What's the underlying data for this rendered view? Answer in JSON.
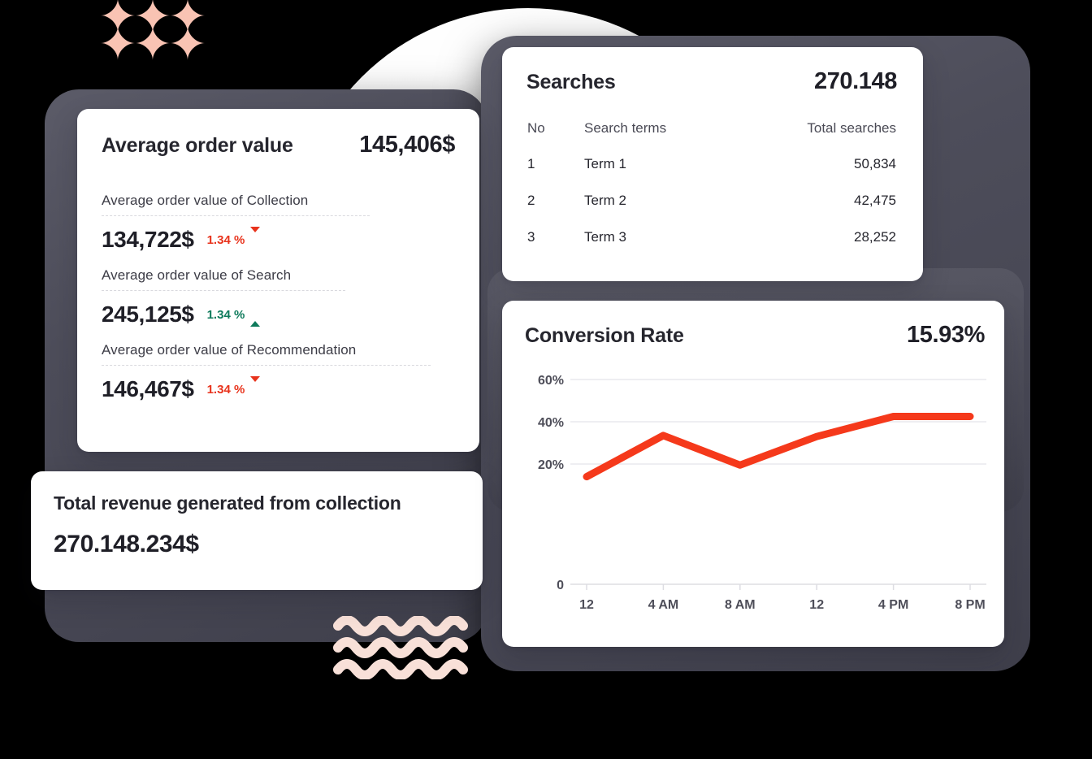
{
  "theme": {
    "background": "#000000",
    "device_frame": "#4a4a56",
    "card_background": "#ffffff",
    "text_primary": "#26262e",
    "text_secondary": "#4a4a55",
    "accent_negative": "#e8331c",
    "accent_positive": "#0e7a5b",
    "chart_line": "#f5391b",
    "decor_star": "#f9c3b3",
    "decor_wave": "#f8e0d8"
  },
  "average_order_value": {
    "title": "Average order value",
    "total": "145,406$",
    "metrics": [
      {
        "label": "Average order value of Collection",
        "value": "134,722$",
        "delta": "1.34 %",
        "direction": "down"
      },
      {
        "label": "Average order value of Search",
        "value": "245,125$",
        "delta": "1.34 %",
        "direction": "up"
      },
      {
        "label": "Average order value of Recommendation",
        "value": "146,467$",
        "delta": "1.34 %",
        "direction": "down"
      }
    ]
  },
  "total_revenue": {
    "title": "Total revenue generated from collection",
    "value": "270.148.234$"
  },
  "searches": {
    "title": "Searches",
    "total": "270.148",
    "columns": [
      "No",
      "Search terms",
      "Total searches"
    ],
    "rows": [
      {
        "no": "1",
        "term": "Term 1",
        "total": "50,834"
      },
      {
        "no": "2",
        "term": "Term 2",
        "total": "42,475"
      },
      {
        "no": "3",
        "term": "Term 3",
        "total": "28,252"
      }
    ]
  },
  "conversion_rate": {
    "title": "Conversion Rate",
    "value": "15.93%"
  },
  "chart_data": {
    "type": "line",
    "title": "Conversion Rate",
    "xlabel": "",
    "ylabel": "",
    "x": [
      "12",
      "4 AM",
      "8 AM",
      "12",
      "4 PM",
      "8 PM"
    ],
    "series": [
      {
        "name": "Conversion Rate",
        "color": "#f5391b",
        "values": [
          14,
          33.5,
          19.5,
          33,
          42.5,
          42.5
        ]
      }
    ],
    "ytick_labels": [
      "60%",
      "40%",
      "20%",
      "0"
    ],
    "ytick_values": [
      60,
      40,
      20,
      0
    ],
    "ylim": [
      0,
      60
    ],
    "grid": true,
    "legend": "none"
  },
  "decorations": {
    "star_grid": {
      "name": "four-point-star-grid",
      "columns": 3,
      "rows": 2
    },
    "wave_lines": {
      "name": "wavy-lines",
      "count": 3
    }
  }
}
